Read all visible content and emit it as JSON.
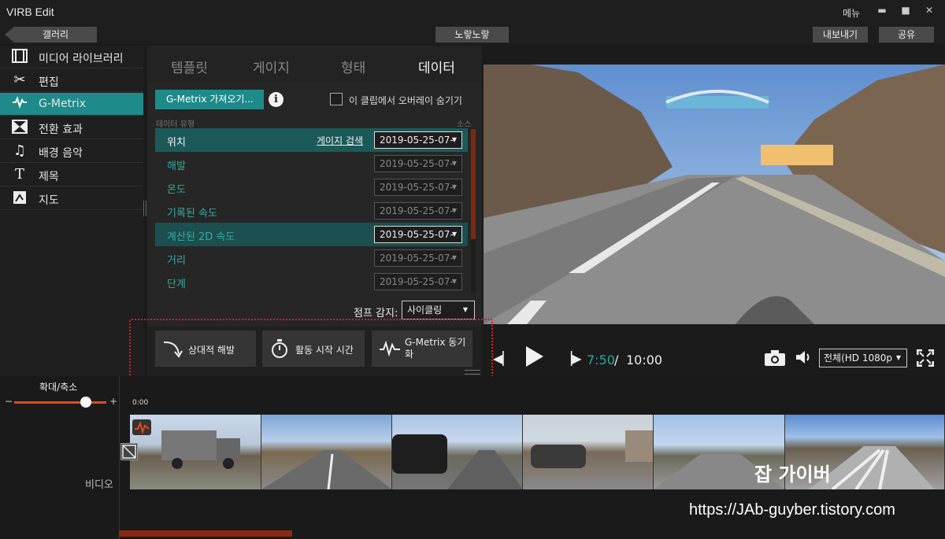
{
  "window": {
    "title": "VIRB Edit",
    "menu_label": "메뉴",
    "minimize": "▬",
    "maximize": "■",
    "close": "✕"
  },
  "toolbar": {
    "gallery_label": "갤러리",
    "project_name": "노랗노랗",
    "export_label": "내보내기",
    "share_label": "공유"
  },
  "sidebar": {
    "items": [
      {
        "label": "미디어 라이브러리",
        "icon": "film-icon"
      },
      {
        "label": "편집",
        "icon": "scissors-icon"
      },
      {
        "label": "G-Metrix",
        "icon": "gmetrix-icon",
        "active": true
      },
      {
        "label": "전환 효과",
        "icon": "transition-icon"
      },
      {
        "label": "배경 음악",
        "icon": "music-note-icon"
      },
      {
        "label": "제목",
        "icon": "title-t-icon"
      },
      {
        "label": "지도",
        "icon": "map-icon"
      }
    ]
  },
  "panel": {
    "tabs": [
      "템플릿",
      "게이지",
      "형태",
      "데이터"
    ],
    "active_tab": "데이터",
    "import_button": "G-Metrix 가져오기...",
    "hide_overlay_label": "이 클립에서 오버레이 숨기기",
    "col_data_type": "데이터 유형",
    "col_source": "소스",
    "rows": [
      {
        "name": "위치",
        "search": "게이지 검색",
        "date": "2019-05-25-07-",
        "selected": true
      },
      {
        "name": "해발",
        "date": "2019-05-25-07-"
      },
      {
        "name": "온도",
        "date": "2019-05-25-07-"
      },
      {
        "name": "기록된 속도",
        "date": "2019-05-25-07-"
      },
      {
        "name": "계산된 2D 속도",
        "date": "2019-05-25-07-",
        "selected": true
      },
      {
        "name": "거리",
        "date": "2019-05-25-07-"
      },
      {
        "name": "단계",
        "date": "2019-05-25-07-"
      }
    ],
    "jump_label": "점프 감지:",
    "jump_value": "사이클링"
  },
  "actions": {
    "relative_elevation": "상대적 해발",
    "activity_start": "활동 시작 시간",
    "gmetrix_sync_line1": "G-Metrix 동기",
    "gmetrix_sync_line2": "화"
  },
  "player": {
    "current_time": "7:50",
    "separator": "/",
    "total_time": "10:00",
    "quality": "전체(HD 1080p"
  },
  "timeline": {
    "zoom_label": "확대/축소",
    "zoom_minus": "−",
    "zoom_plus": "+",
    "zoom_level": 0.75,
    "ruler_start": "0:00",
    "track_label": "비디오"
  },
  "watermark": {
    "name": "잡 가이버",
    "url": "https://JAb-guyber.tistory.com"
  },
  "colors": {
    "accent": "#1f8a8a",
    "highlight": "#e21a1a",
    "time_accent": "#2aa8a0",
    "scroll": "#8a2a10"
  }
}
